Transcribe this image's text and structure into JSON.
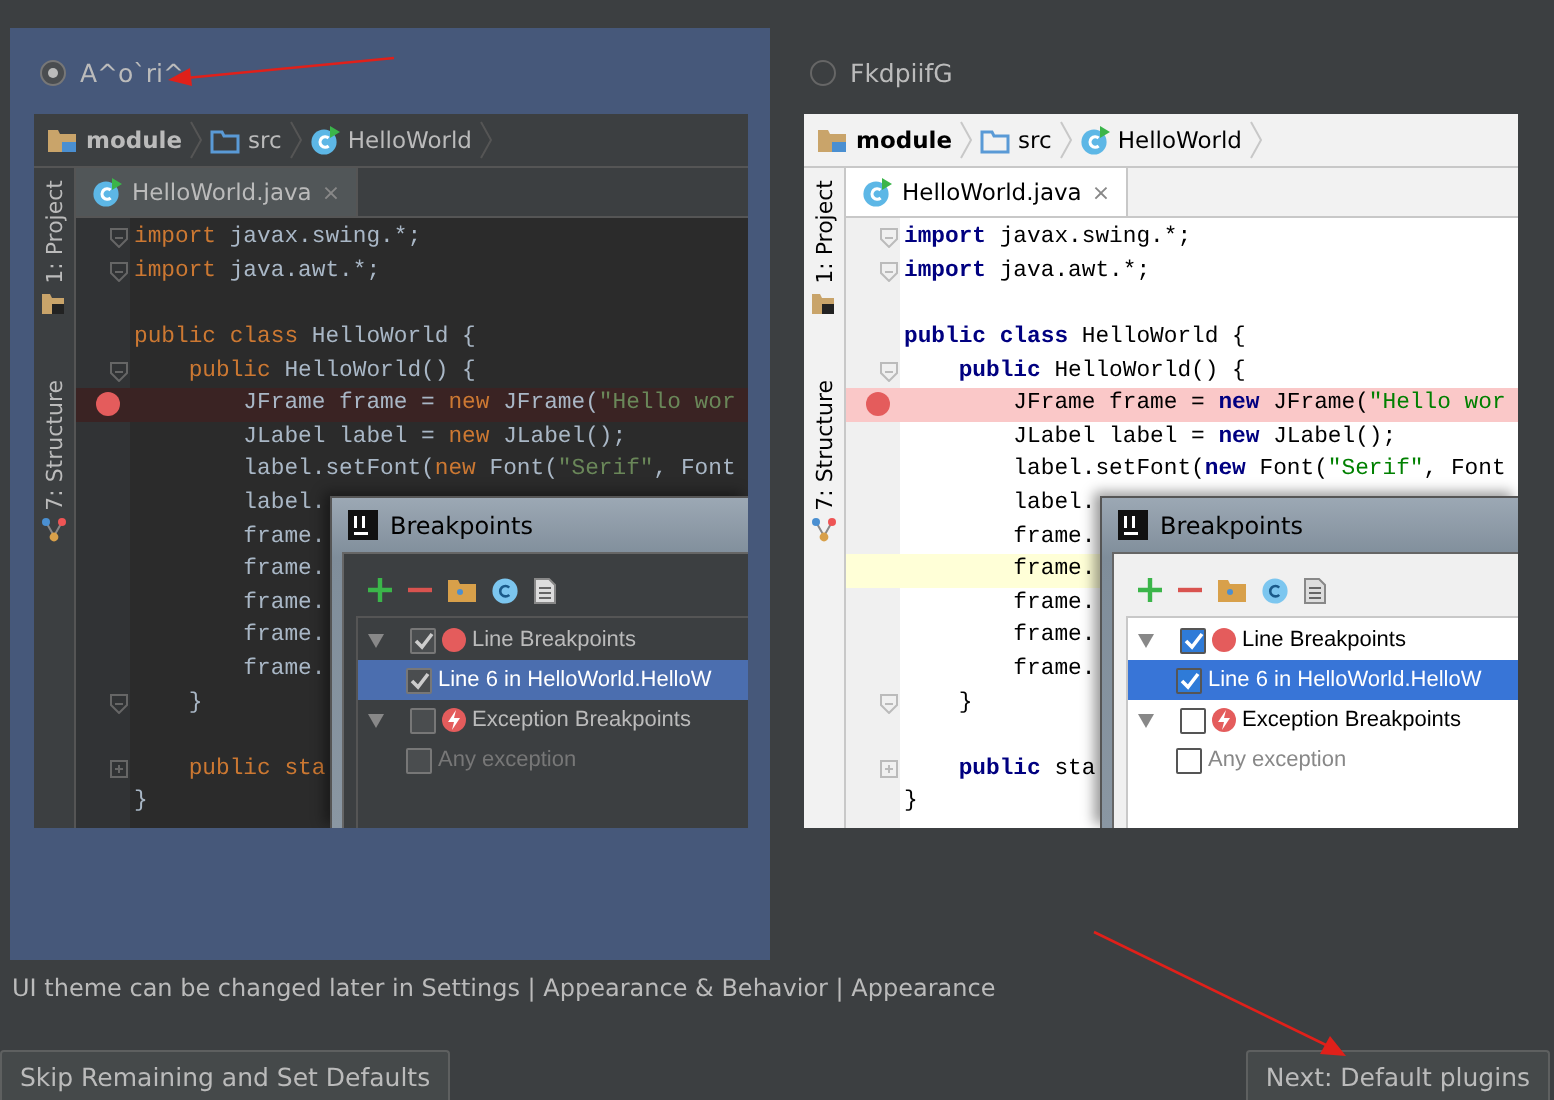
{
  "themes": [
    {
      "label": "A^o`ri^",
      "selected": true,
      "dark": true,
      "breadcrumbs": [
        {
          "label": "module",
          "kind": "module"
        },
        {
          "label": "src",
          "kind": "folder"
        },
        {
          "label": "HelloWorld",
          "kind": "class"
        }
      ],
      "tab": {
        "label": "HelloWorld.java",
        "close": "×"
      },
      "side_tabs": [
        {
          "label": "1: Project",
          "kind": "project"
        },
        {
          "label": "7: Structure",
          "kind": "structure"
        }
      ],
      "code_lines": [
        {
          "kind": "code",
          "folded": false,
          "breakpoint": false,
          "current": false,
          "tokens": [
            {
              "kind": "kw",
              "text": "import"
            },
            {
              "kind": "plain",
              "text": " javax.swing.*;"
            }
          ]
        },
        {
          "kind": "code",
          "folded": false,
          "breakpoint": false,
          "current": false,
          "tokens": [
            {
              "kind": "kw",
              "text": "import"
            },
            {
              "kind": "plain",
              "text": " java.awt.*;"
            }
          ]
        },
        {
          "kind": "blank",
          "breakpoint": false,
          "current": false
        },
        {
          "kind": "code",
          "breakpoint": false,
          "current": false,
          "tokens": [
            {
              "kind": "kw",
              "text": "public class"
            },
            {
              "kind": "plain",
              "text": " HelloWorld {"
            }
          ]
        },
        {
          "kind": "code",
          "folded": false,
          "breakpoint": false,
          "current": false,
          "tokens": [
            {
              "kind": "kw",
              "text": "    public"
            },
            {
              "kind": "plain",
              "text": " HelloWorld() {"
            }
          ]
        },
        {
          "kind": "code",
          "breakpoint": true,
          "current": false,
          "tokens": [
            {
              "kind": "plain",
              "text": "        JFrame frame = "
            },
            {
              "kind": "kw",
              "text": "new"
            },
            {
              "kind": "plain",
              "text": " JFrame("
            },
            {
              "kind": "str",
              "text": "\"Hello wor"
            }
          ]
        },
        {
          "kind": "code",
          "breakpoint": false,
          "current": false,
          "tokens": [
            {
              "kind": "plain",
              "text": "        JLabel label = "
            },
            {
              "kind": "kw",
              "text": "new"
            },
            {
              "kind": "plain",
              "text": " JLabel();"
            }
          ]
        },
        {
          "kind": "code",
          "breakpoint": false,
          "current": false,
          "tokens": [
            {
              "kind": "plain",
              "text": "        label.setFont("
            },
            {
              "kind": "kw",
              "text": "new"
            },
            {
              "kind": "plain",
              "text": " Font("
            },
            {
              "kind": "str",
              "text": "\"Serif\""
            },
            {
              "kind": "plain",
              "text": ", Font"
            }
          ]
        },
        {
          "kind": "code",
          "breakpoint": false,
          "current": false,
          "tokens": [
            {
              "kind": "plain",
              "text": "        label."
            }
          ]
        },
        {
          "kind": "code",
          "breakpoint": false,
          "current": false,
          "tokens": [
            {
              "kind": "plain",
              "text": "        frame."
            }
          ]
        },
        {
          "kind": "code",
          "breakpoint": false,
          "current": false,
          "tokens": [
            {
              "kind": "plain",
              "text": "        frame."
            }
          ]
        },
        {
          "kind": "code",
          "breakpoint": false,
          "current": false,
          "tokens": [
            {
              "kind": "plain",
              "text": "        frame."
            }
          ]
        },
        {
          "kind": "code",
          "breakpoint": false,
          "current": false,
          "tokens": [
            {
              "kind": "plain",
              "text": "        frame."
            }
          ]
        },
        {
          "kind": "code",
          "breakpoint": false,
          "current": false,
          "tokens": [
            {
              "kind": "plain",
              "text": "        frame."
            }
          ]
        },
        {
          "kind": "code",
          "folded": false,
          "breakpoint": false,
          "current": false,
          "tokens": [
            {
              "kind": "plain",
              "text": "    }"
            }
          ]
        },
        {
          "kind": "blank",
          "breakpoint": false,
          "current": false
        },
        {
          "kind": "code",
          "folded": true,
          "breakpoint": false,
          "current": false,
          "tokens": [
            {
              "kind": "kw",
              "text": "    public sta"
            }
          ]
        },
        {
          "kind": "code",
          "breakpoint": false,
          "current": false,
          "tokens": [
            {
              "kind": "plain",
              "text": "}"
            }
          ]
        }
      ],
      "dialog": {
        "title": "Breakpoints",
        "tree": [
          {
            "label": "Line Breakpoints",
            "kind": "line-group",
            "expanded": true,
            "checked": true,
            "selected": false,
            "disabled": false,
            "children": [
              {
                "label": "Line 6 in HelloWorld.HelloW",
                "checked": true,
                "selected": true,
                "disabled": false
              }
            ]
          },
          {
            "label": "Exception Breakpoints",
            "kind": "exception-group",
            "expanded": true,
            "checked": false,
            "selected": false,
            "disabled": false,
            "children": [
              {
                "label": "Any exception",
                "checked": false,
                "selected": false,
                "disabled": true
              }
            ]
          }
        ]
      }
    },
    {
      "label": "FkdpiifG",
      "selected": false,
      "dark": false,
      "breadcrumbs": [
        {
          "label": "module",
          "kind": "module"
        },
        {
          "label": "src",
          "kind": "folder"
        },
        {
          "label": "HelloWorld",
          "kind": "class"
        }
      ],
      "tab": {
        "label": "HelloWorld.java",
        "close": "×"
      },
      "side_tabs": [
        {
          "label": "1: Project",
          "kind": "project"
        },
        {
          "label": "7: Structure",
          "kind": "structure"
        }
      ],
      "code_lines": [
        {
          "kind": "code",
          "folded": false,
          "breakpoint": false,
          "current": false,
          "tokens": [
            {
              "kind": "kw",
              "text": "import"
            },
            {
              "kind": "plain",
              "text": " javax.swing.*;"
            }
          ]
        },
        {
          "kind": "code",
          "folded": false,
          "breakpoint": false,
          "current": false,
          "tokens": [
            {
              "kind": "kw",
              "text": "import"
            },
            {
              "kind": "plain",
              "text": " java.awt.*;"
            }
          ]
        },
        {
          "kind": "blank",
          "breakpoint": false,
          "current": false
        },
        {
          "kind": "code",
          "breakpoint": false,
          "current": false,
          "tokens": [
            {
              "kind": "kw",
              "text": "public class"
            },
            {
              "kind": "plain",
              "text": " HelloWorld {"
            }
          ]
        },
        {
          "kind": "code",
          "folded": false,
          "breakpoint": false,
          "current": false,
          "tokens": [
            {
              "kind": "kw",
              "text": "    public"
            },
            {
              "kind": "plain",
              "text": " HelloWorld() {"
            }
          ]
        },
        {
          "kind": "code",
          "breakpoint": true,
          "current": false,
          "tokens": [
            {
              "kind": "plain",
              "text": "        JFrame frame = "
            },
            {
              "kind": "kw",
              "text": "new"
            },
            {
              "kind": "plain",
              "text": " JFrame("
            },
            {
              "kind": "str",
              "text": "\"Hello wor"
            }
          ]
        },
        {
          "kind": "code",
          "breakpoint": false,
          "current": false,
          "tokens": [
            {
              "kind": "plain",
              "text": "        JLabel label = "
            },
            {
              "kind": "kw",
              "text": "new"
            },
            {
              "kind": "plain",
              "text": " JLabel();"
            }
          ]
        },
        {
          "kind": "code",
          "breakpoint": false,
          "current": false,
          "tokens": [
            {
              "kind": "plain",
              "text": "        label.setFont("
            },
            {
              "kind": "kw",
              "text": "new"
            },
            {
              "kind": "plain",
              "text": " Font("
            },
            {
              "kind": "str",
              "text": "\"Serif\""
            },
            {
              "kind": "plain",
              "text": ", Font"
            }
          ]
        },
        {
          "kind": "code",
          "breakpoint": false,
          "current": false,
          "tokens": [
            {
              "kind": "plain",
              "text": "        label."
            }
          ]
        },
        {
          "kind": "code",
          "breakpoint": false,
          "current": false,
          "tokens": [
            {
              "kind": "plain",
              "text": "        frame."
            }
          ]
        },
        {
          "kind": "code",
          "breakpoint": false,
          "current": true,
          "tokens": [
            {
              "kind": "plain",
              "text": "        frame."
            }
          ]
        },
        {
          "kind": "code",
          "breakpoint": false,
          "current": false,
          "tokens": [
            {
              "kind": "plain",
              "text": "        frame."
            }
          ]
        },
        {
          "kind": "code",
          "breakpoint": false,
          "current": false,
          "tokens": [
            {
              "kind": "plain",
              "text": "        frame."
            }
          ]
        },
        {
          "kind": "code",
          "breakpoint": false,
          "current": false,
          "tokens": [
            {
              "kind": "plain",
              "text": "        frame."
            }
          ]
        },
        {
          "kind": "code",
          "folded": false,
          "breakpoint": false,
          "current": false,
          "tokens": [
            {
              "kind": "plain",
              "text": "    }"
            }
          ]
        },
        {
          "kind": "blank",
          "breakpoint": false,
          "current": false
        },
        {
          "kind": "code",
          "folded": true,
          "breakpoint": false,
          "current": false,
          "tokens": [
            {
              "kind": "kw",
              "text": "    public"
            },
            {
              "kind": "plain",
              "text": " sta"
            }
          ]
        },
        {
          "kind": "code",
          "breakpoint": false,
          "current": false,
          "tokens": [
            {
              "kind": "plain",
              "text": "}"
            }
          ]
        }
      ],
      "dialog": {
        "title": "Breakpoints",
        "tree": [
          {
            "label": "Line Breakpoints",
            "kind": "line-group",
            "expanded": true,
            "checked": true,
            "selected": false,
            "disabled": false,
            "children": [
              {
                "label": "Line 6 in HelloWorld.HelloW",
                "checked": true,
                "selected": true,
                "disabled": false
              }
            ]
          },
          {
            "label": "Exception Breakpoints",
            "kind": "exception-group",
            "expanded": true,
            "checked": false,
            "selected": false,
            "disabled": false,
            "children": [
              {
                "label": "Any exception",
                "checked": false,
                "selected": false,
                "disabled": true
              }
            ]
          }
        ]
      }
    }
  ],
  "hint": "UI theme can be changed later in Settings | Appearance & Behavior | Appearance",
  "buttons": [
    "Skip Remaining and Set Defaults",
    "Next: Default plugins"
  ]
}
